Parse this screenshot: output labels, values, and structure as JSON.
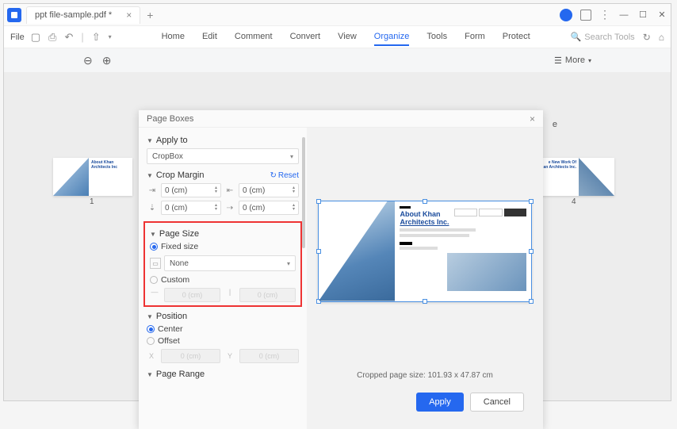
{
  "titlebar": {
    "filename": "ppt file-sample.pdf *"
  },
  "menubar": {
    "file": "File",
    "items": [
      "Home",
      "Edit",
      "Comment",
      "Convert",
      "View",
      "Organize",
      "Tools",
      "Form",
      "Protect"
    ],
    "active": "Organize",
    "search": "Search Tools"
  },
  "toolbar": {
    "more": "More"
  },
  "thumbs": {
    "n1": "1",
    "n4": "4"
  },
  "dialog": {
    "title": "Page Boxes",
    "apply_to": {
      "label": "Apply to",
      "value": "CropBox"
    },
    "crop_margin": {
      "label": "Crop Margin",
      "reset": "Reset",
      "top": "0 (cm)",
      "bottom": "0 (cm)",
      "left": "0 (cm)",
      "right": "0 (cm)"
    },
    "page_size": {
      "label": "Page Size",
      "fixed": "Fixed size",
      "none": "None",
      "custom": "Custom",
      "w_placeholder": "0 (cm)",
      "h_placeholder": "0 (cm)"
    },
    "position": {
      "label": "Position",
      "center": "Center",
      "offset": "Offset",
      "x_ph": "0 (cm)",
      "y_ph": "0 (cm)",
      "y_lbl": "Y"
    },
    "page_range": {
      "label": "Page Range"
    },
    "preview": {
      "title1": "About Khan",
      "title2": "Architects Inc.",
      "info": "Cropped page size: 101.93 x 47.87 cm"
    },
    "buttons": {
      "apply": "Apply",
      "cancel": "Cancel"
    }
  },
  "thumb_text": {
    "left_t1": "About Khan",
    "left_t2": "Architects Inc",
    "right_t1": "e New Work Of",
    "right_t2": "an Architects Inc."
  }
}
